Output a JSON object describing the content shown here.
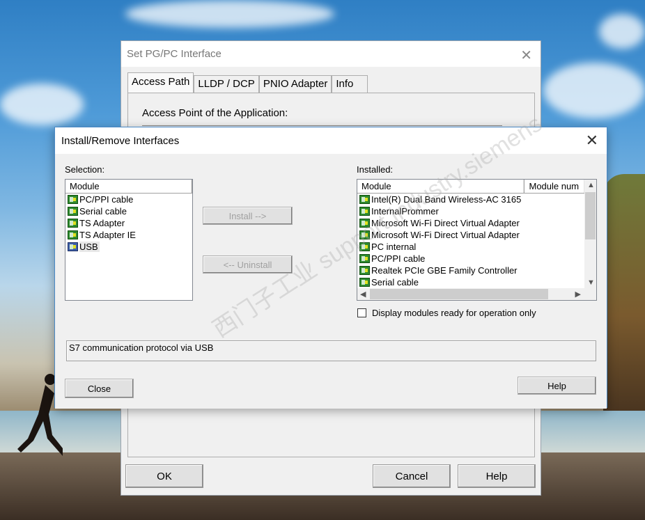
{
  "back_window": {
    "title": "Set PG/PC Interface",
    "tabs": [
      {
        "label": "Access Path",
        "active": true
      },
      {
        "label": "LLDP / DCP",
        "active": false
      },
      {
        "label": "PNIO Adapter",
        "active": false
      },
      {
        "label": "Info",
        "active": false
      }
    ],
    "access_point_label": "Access Point of the Application:",
    "buttons": {
      "ok": "OK",
      "cancel": "Cancel",
      "help": "Help"
    }
  },
  "dialog": {
    "title": "Install/Remove Interfaces",
    "selection_label": "Selection:",
    "installed_label": "Installed:",
    "selection_list": {
      "header": "Module",
      "items": [
        {
          "label": "PC/PPI cable",
          "icon": "module-icon"
        },
        {
          "label": "Serial cable",
          "icon": "module-icon"
        },
        {
          "label": "TS Adapter",
          "icon": "module-icon"
        },
        {
          "label": "TS Adapter IE",
          "icon": "module-icon"
        },
        {
          "label": "USB",
          "icon": "usb-module-icon",
          "selected": true
        }
      ]
    },
    "installed_list": {
      "headers": [
        "Module",
        "Module num"
      ],
      "items": [
        "Intel(R) Dual Band Wireless-AC 3165",
        "InternalPrommer",
        "Microsoft Wi-Fi Direct Virtual Adapter",
        "Microsoft Wi-Fi Direct Virtual Adapter",
        "PC internal",
        "PC/PPI cable",
        "Realtek PCIe GBE Family Controller",
        "Serial cable"
      ]
    },
    "install_button": "Install -->",
    "uninstall_button": "<-- Uninstall",
    "checkbox_label": "Display modules ready for operation only",
    "checkbox_checked": false,
    "status_text": "S7 communication protocol via USB",
    "close_button": "Close",
    "help_button": "Help",
    "watermark": "西门子工业 support.industry.siemens"
  }
}
